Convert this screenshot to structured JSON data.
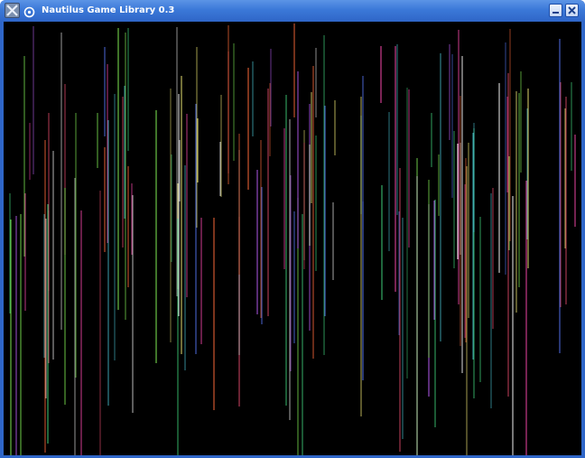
{
  "window": {
    "title": "Nautilus Game Library 0.3",
    "titlebar_color": "#3b78d8"
  },
  "titlebar": {
    "app_icon": "app-icon",
    "menu_icon": "window-menu-icon",
    "minimize_icon": "minimize-icon",
    "close_icon": "close-icon"
  },
  "canvas": {
    "background": "#000000",
    "content": "falling colored vertical streaks (rain effect)",
    "streak_colors": [
      "#e24a6a",
      "#5a7bff",
      "#3fd07a",
      "#c060ff",
      "#ffffff",
      "#e8e070",
      "#4fd0e0",
      "#ff6a3a",
      "#8aff5a",
      "#ff4ab0"
    ]
  }
}
